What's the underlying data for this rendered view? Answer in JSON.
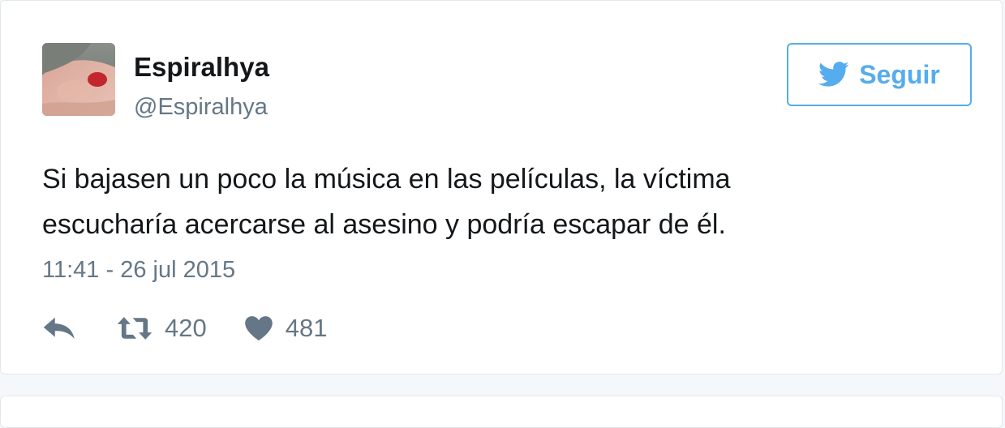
{
  "user": {
    "display_name": "Espiralhya",
    "screen_name": "@Espiralhya",
    "avatar_icon": "user-photo-avatar"
  },
  "follow_button": {
    "label": "Seguir",
    "icon": "twitter-bird-icon",
    "color": "#55acee"
  },
  "tweet": {
    "text_lines": [
      "Si bajasen un poco la música en las películas, la víctima",
      "escucharía acercarse al asesino y podría escapar de él."
    ],
    "timestamp": "11:41 - 26 jul 2015"
  },
  "actions": {
    "reply_icon": "reply-icon",
    "retweet_icon": "retweet-icon",
    "retweet_count": "420",
    "like_icon": "heart-icon",
    "like_count": "481"
  },
  "colors": {
    "text": "#14171a",
    "muted": "#657786",
    "border": "#e1e8ed",
    "accent": "#55acee"
  }
}
